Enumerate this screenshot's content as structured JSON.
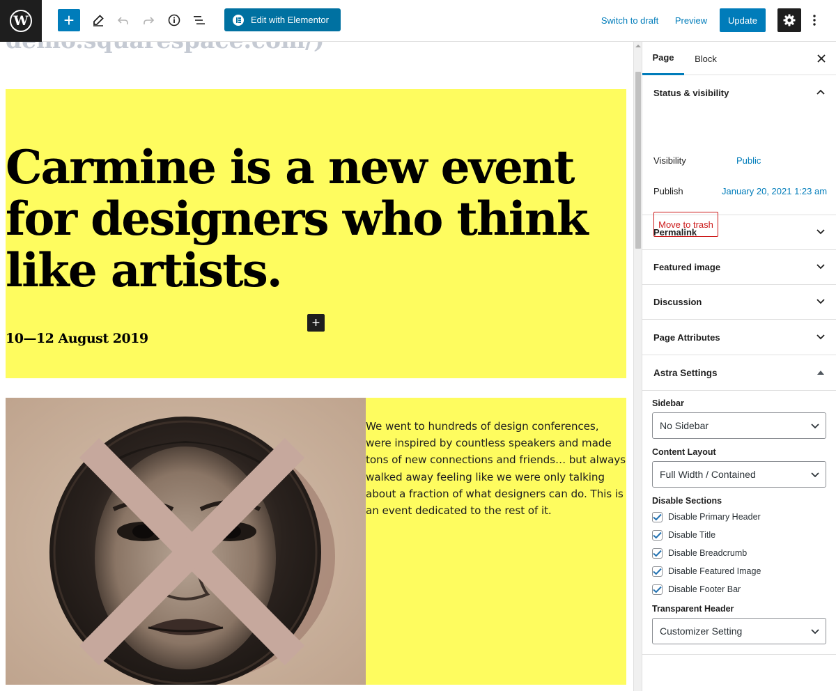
{
  "toolbar": {
    "logo_letter": "W",
    "inserter_label": "+",
    "elementor_label": "Edit with Elementor",
    "switch_draft_label": "Switch to draft",
    "preview_label": "Preview",
    "update_label": "Update"
  },
  "canvas": {
    "cut_text": "demo.squarespace.com/)",
    "hero_title": "Carmine is a new event for designers who think like artists.",
    "hero_date": "10—12 August 2019",
    "block_add_label": "+",
    "media_text": "We went to hundreds of design conferences, were inspired by countless speakers and made tons of new connections and friends… but always walked away feeling like we were only talking about a fraction of what designers can do. This is an event dedicated to the rest of it.",
    "colors": {
      "hero_bg": "#fefc5f",
      "accent": "#007cba"
    }
  },
  "sidebar": {
    "tabs": [
      "Page",
      "Block"
    ],
    "status": {
      "title": "Status & visibility",
      "visibility_label": "Visibility",
      "visibility_value": "Public",
      "publish_label": "Publish",
      "publish_value": "January 20, 2021 1:23 am",
      "trash_label": "Move to trash"
    },
    "panels": [
      "Permalink",
      "Featured image",
      "Discussion",
      "Page Attributes"
    ],
    "astra": {
      "title": "Astra Settings",
      "sidebar_label": "Sidebar",
      "sidebar_value": "No Sidebar",
      "layout_label": "Content Layout",
      "layout_value": "Full Width / Contained",
      "disable_label": "Disable Sections",
      "checkboxes": [
        "Disable Primary Header",
        "Disable Title",
        "Disable Breadcrumb",
        "Disable Featured Image",
        "Disable Footer Bar"
      ],
      "transparent_label": "Transparent Header",
      "transparent_value": "Customizer Setting"
    }
  }
}
